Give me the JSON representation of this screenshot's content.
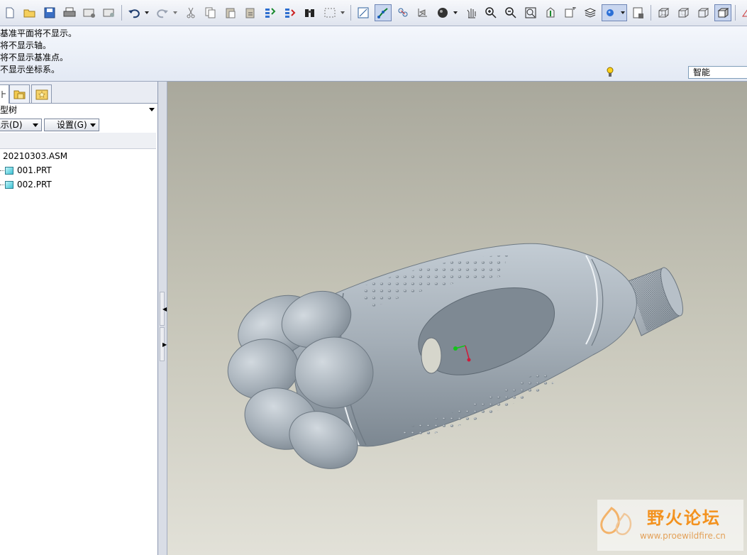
{
  "messages": [
    "基准平面将不显示。",
    "将不显示轴。",
    "将不显示基准点。",
    "不显示坐标系。"
  ],
  "status": {
    "filter_value": "智能"
  },
  "navigator": {
    "tree_title": "模型树",
    "buttons": {
      "show": "显示(D)",
      "settings": "设置(G)"
    },
    "tree": {
      "root": "20210303.ASM",
      "children": [
        "001.PRT",
        "002.PRT"
      ]
    }
  },
  "watermark": {
    "name": "野火论坛",
    "url": "www.proewildfire.cn"
  },
  "colors": {
    "accent": "#f3921f",
    "model": "#a3adb6",
    "background_top": "#a9a89c",
    "background_bottom": "#e2e1d8"
  }
}
